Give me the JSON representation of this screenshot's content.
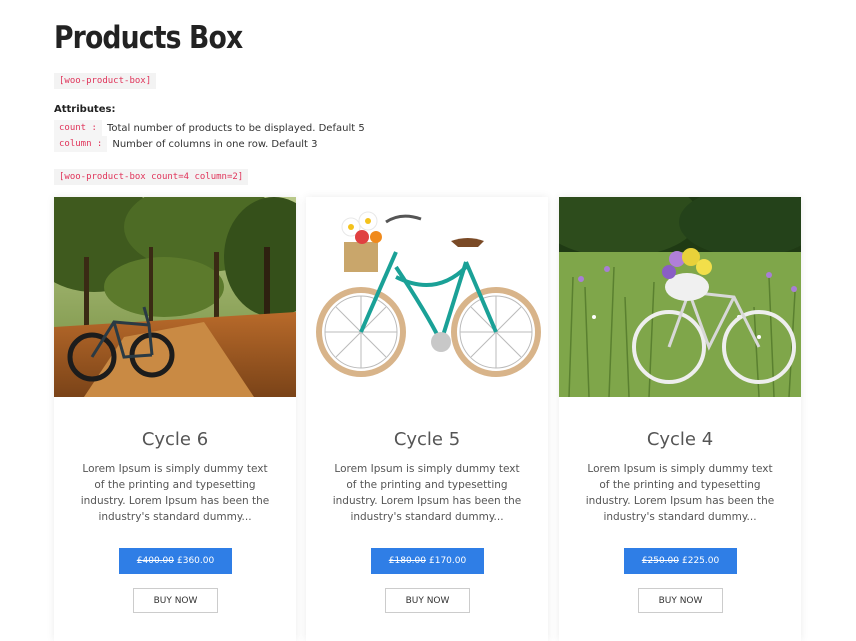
{
  "page": {
    "title": "Products Box",
    "shortcode": "[woo-product-box]",
    "attributes_heading": "Attributes:",
    "attributes": [
      {
        "name": "count :",
        "description": "Total number of products to be displayed. Default 5"
      },
      {
        "name": "column :",
        "description": "Number of columns in one row. Default 3"
      }
    ],
    "example_shortcode": "[woo-product-box count=4 column=2]"
  },
  "products": [
    {
      "name": "Cycle 6",
      "image_icon": "mountain-bike-forest-image",
      "description": "Lorem Ipsum is simply dummy text of the printing and typesetting industry. Lorem Ipsum has been the industry's standard dummy...",
      "old_price": "£400.00",
      "price": "£360.00",
      "buy_label": "BUY NOW"
    },
    {
      "name": "Cycle 5",
      "image_icon": "teal-cruiser-bike-image",
      "description": "Lorem Ipsum is simply dummy text of the printing and typesetting industry. Lorem Ipsum has been the industry's standard dummy...",
      "old_price": "£180.00",
      "price": "£170.00",
      "buy_label": "BUY NOW"
    },
    {
      "name": "Cycle 4",
      "image_icon": "white-bike-meadow-image",
      "description": "Lorem Ipsum is simply dummy text of the printing and typesetting industry. Lorem Ipsum has been the industry's standard dummy...",
      "old_price": "£250.00",
      "price": "£225.00",
      "buy_label": "BUY NOW"
    }
  ],
  "colors": {
    "price_button": "#2f7ee6",
    "code_text": "#e0345a"
  }
}
